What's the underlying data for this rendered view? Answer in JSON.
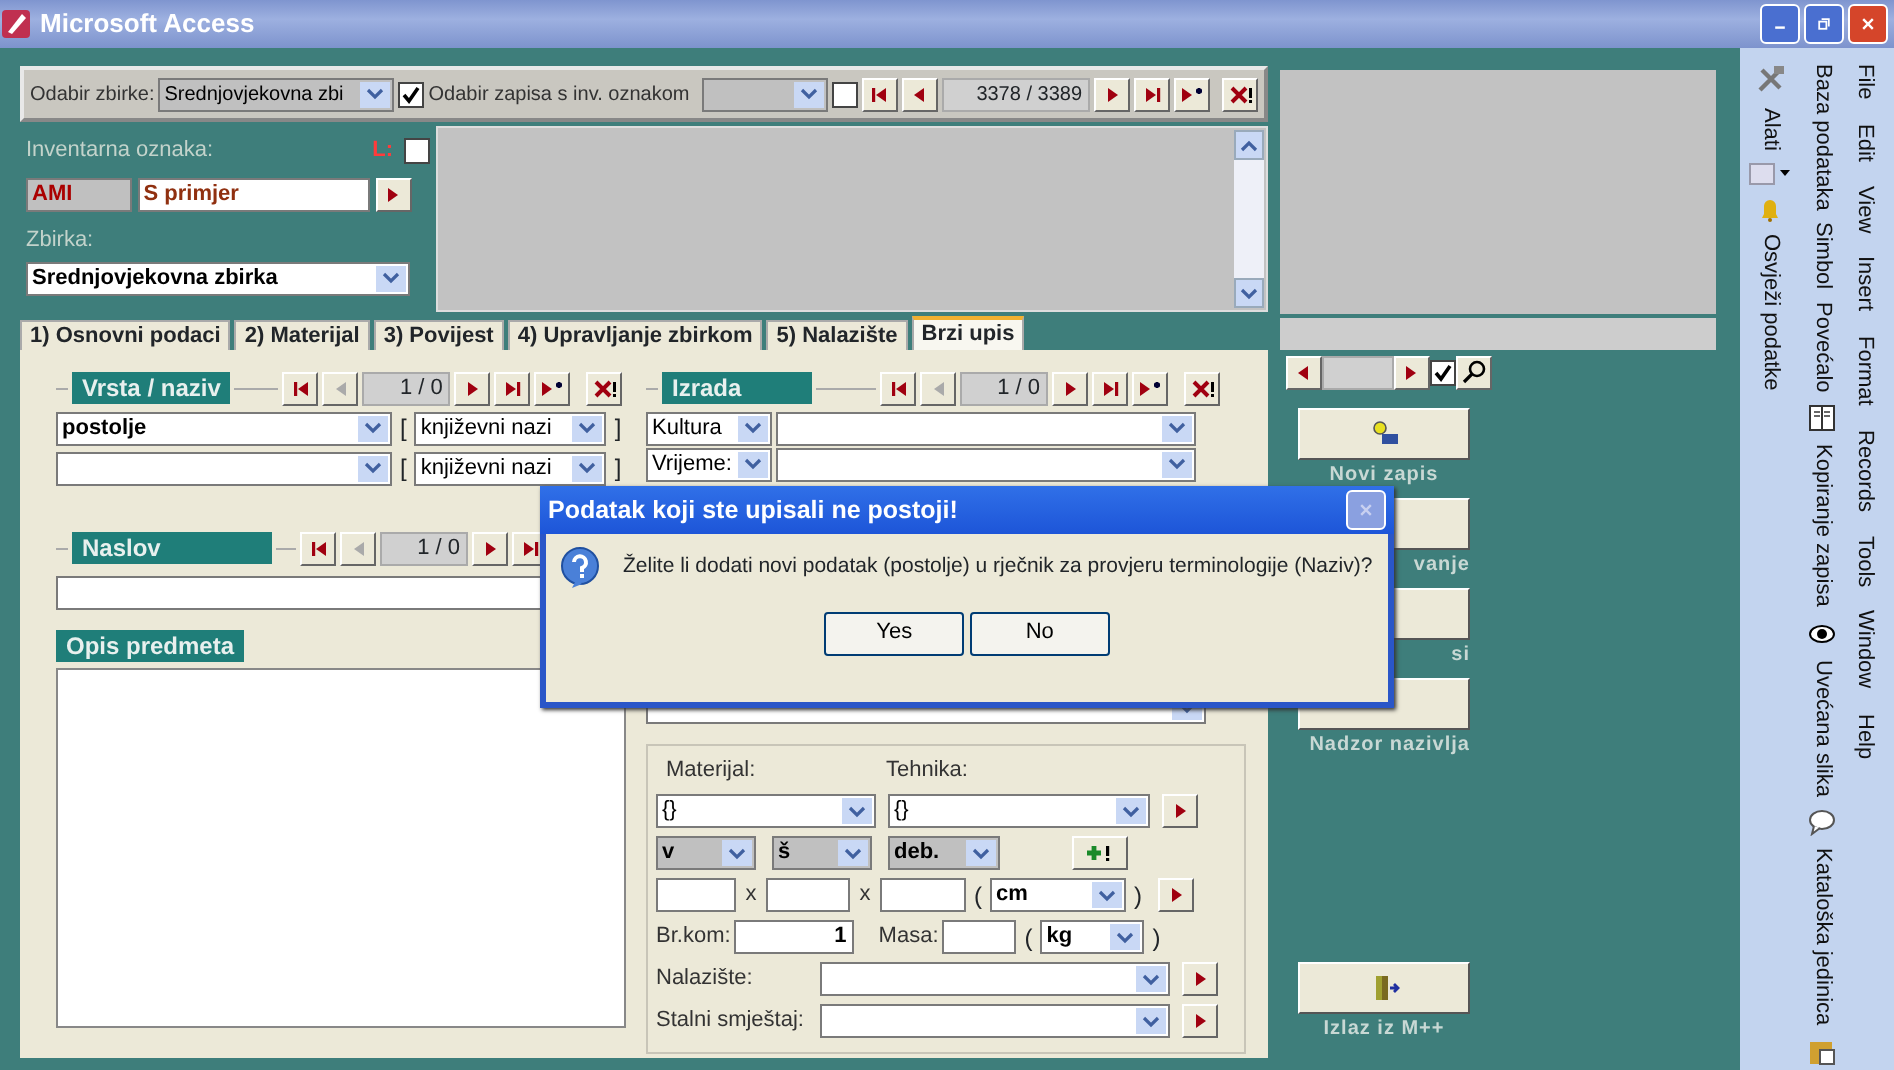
{
  "window": {
    "title": "Microsoft Access"
  },
  "record_bar": {
    "collection_label": "Odabir zbirke:",
    "collection_value": "Srednjovjekovna zbi",
    "collection_checked": true,
    "inv_label": "Odabir zapisa s inv. oznakom",
    "inv_checked": false,
    "counter": "3378 / 3389"
  },
  "header": {
    "inv_label": "Inventarna oznaka:",
    "l_label": "L:",
    "l_checked": false,
    "prefix": "AMI",
    "inv_value": "S primjer",
    "collection_label": "Zbirka:",
    "collection_value": "Srednjovjekovna zbirka"
  },
  "tabs": [
    {
      "number": "1)",
      "label": "Osnovni podaci",
      "selected": false
    },
    {
      "number": "2)",
      "label": "Materijal",
      "selected": false
    },
    {
      "number": "3)",
      "label": "Povijest",
      "selected": false
    },
    {
      "number": "4)",
      "label": "Upravljanje zbirkom",
      "selected": false
    },
    {
      "number": "5)",
      "label": "Nalazište",
      "selected": false
    },
    {
      "label": "Brzi upis",
      "selected": true
    }
  ],
  "vrsta": {
    "title": "Vrsta / naziv",
    "counter": "1 / 0",
    "rows": [
      {
        "value": "postolje",
        "open": "[",
        "type": "književni nazi",
        "close": "]"
      },
      {
        "open": "[",
        "type": "književni nazi",
        "close": "]"
      }
    ]
  },
  "naslov": {
    "title": "Naslov",
    "counter": "1 / 0"
  },
  "opis": {
    "title": "Opis predmeta"
  },
  "izrada": {
    "title": "Izrada",
    "counter": "1 / 0",
    "culture_label": "Kultura",
    "time_label": "Vrijeme:"
  },
  "material": {
    "material_label": "Materijal:",
    "technique_label": "Tehnika:",
    "material_value": "{}",
    "technique_value": "{}",
    "dims": [
      "v",
      "š",
      "deb."
    ],
    "times": [
      "x",
      "x"
    ],
    "unit_open": "(",
    "unit": "cm",
    "unit_close": ")",
    "count_label": "Br.kom:",
    "count": "1",
    "mass_label": "Masa:",
    "mass_open": "(",
    "mass_unit": "kg",
    "mass_close": ")",
    "site_label": "Nalazište:",
    "storage_label": "Stalni smještaj:"
  },
  "right_nav": {
    "checked": true
  },
  "side_buttons": [
    {
      "kind": "new",
      "label": "Novi zapis"
    },
    {
      "kind": "hidden",
      "label": "vanje"
    },
    {
      "kind": "hidden",
      "label": "si"
    },
    {
      "kind": "hidden",
      "label": "Nadzor nazivlja"
    },
    {
      "kind": "exit",
      "label": "Izlaz iz M++"
    }
  ],
  "toolbar": {
    "tools_label": "Alati",
    "refresh_label": "Osvježi podatke",
    "items": [
      "Baza podataka",
      "Simbol",
      "Povećalo",
      "Kopiranje zapisa",
      "Uvećana slika",
      "Kataloška jedinica"
    ]
  },
  "menu": [
    "File",
    "Edit",
    "View",
    "Insert",
    "Format",
    "Records",
    "Tools",
    "Window",
    "Help"
  ],
  "dialog": {
    "title": "Podatak koji ste upisali ne postoji!",
    "message": "Želite li dodati novi podatak (postolje) u rječnik za provjeru terminologije (Naziv)?",
    "buttons": [
      "Yes",
      "No"
    ]
  }
}
